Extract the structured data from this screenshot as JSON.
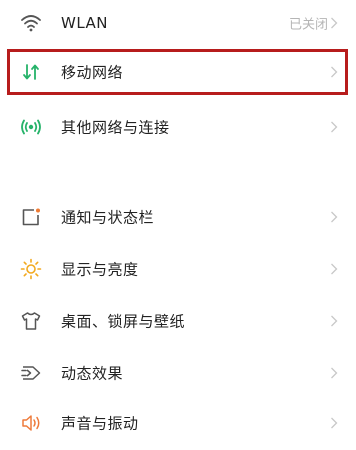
{
  "settings": {
    "items": [
      {
        "label": "WLAN",
        "value": "已关闭",
        "icon": "wifi-icon"
      },
      {
        "label": "移动网络",
        "value": "",
        "icon": "mobile-data-icon"
      },
      {
        "label": "其他网络与连接",
        "value": "",
        "icon": "connection-icon"
      },
      {
        "label": "通知与状态栏",
        "value": "",
        "icon": "notification-icon"
      },
      {
        "label": "显示与亮度",
        "value": "",
        "icon": "brightness-icon"
      },
      {
        "label": "桌面、锁屏与壁纸",
        "value": "",
        "icon": "wallpaper-icon"
      },
      {
        "label": "动态效果",
        "value": "",
        "icon": "motion-effect-icon"
      },
      {
        "label": "声音与振动",
        "value": "",
        "icon": "sound-icon"
      }
    ]
  },
  "colors": {
    "accent_green": "#26b36a",
    "notification_orange": "#ef7b33",
    "brightness_yellow": "#f2a91f",
    "sound_orange": "#ee7a3a",
    "highlight_red": "#b71c1c",
    "icon_gray": "#555555",
    "chevron_gray": "#c8c8c8"
  }
}
